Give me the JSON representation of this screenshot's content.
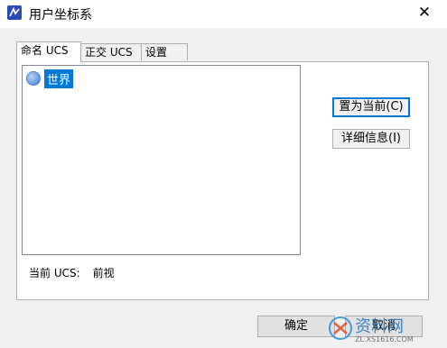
{
  "window": {
    "title": "用户坐标系",
    "close_glyph": "✕"
  },
  "tabs": [
    {
      "label": "命名 UCS"
    },
    {
      "label": "正交 UCS"
    },
    {
      "label": "设置"
    }
  ],
  "list": {
    "items": [
      {
        "label": "世界",
        "icon": "globe-icon"
      }
    ]
  },
  "buttons": {
    "set_current": "置为当前(C)",
    "details": "详细信息(I)",
    "ok": "确定",
    "cancel": "取消"
  },
  "status": {
    "current_ucs_label": "当前 UCS:",
    "current_ucs_value": "前视"
  },
  "watermark": {
    "text": "资料网",
    "url": "ZL.XS1616.COM"
  }
}
